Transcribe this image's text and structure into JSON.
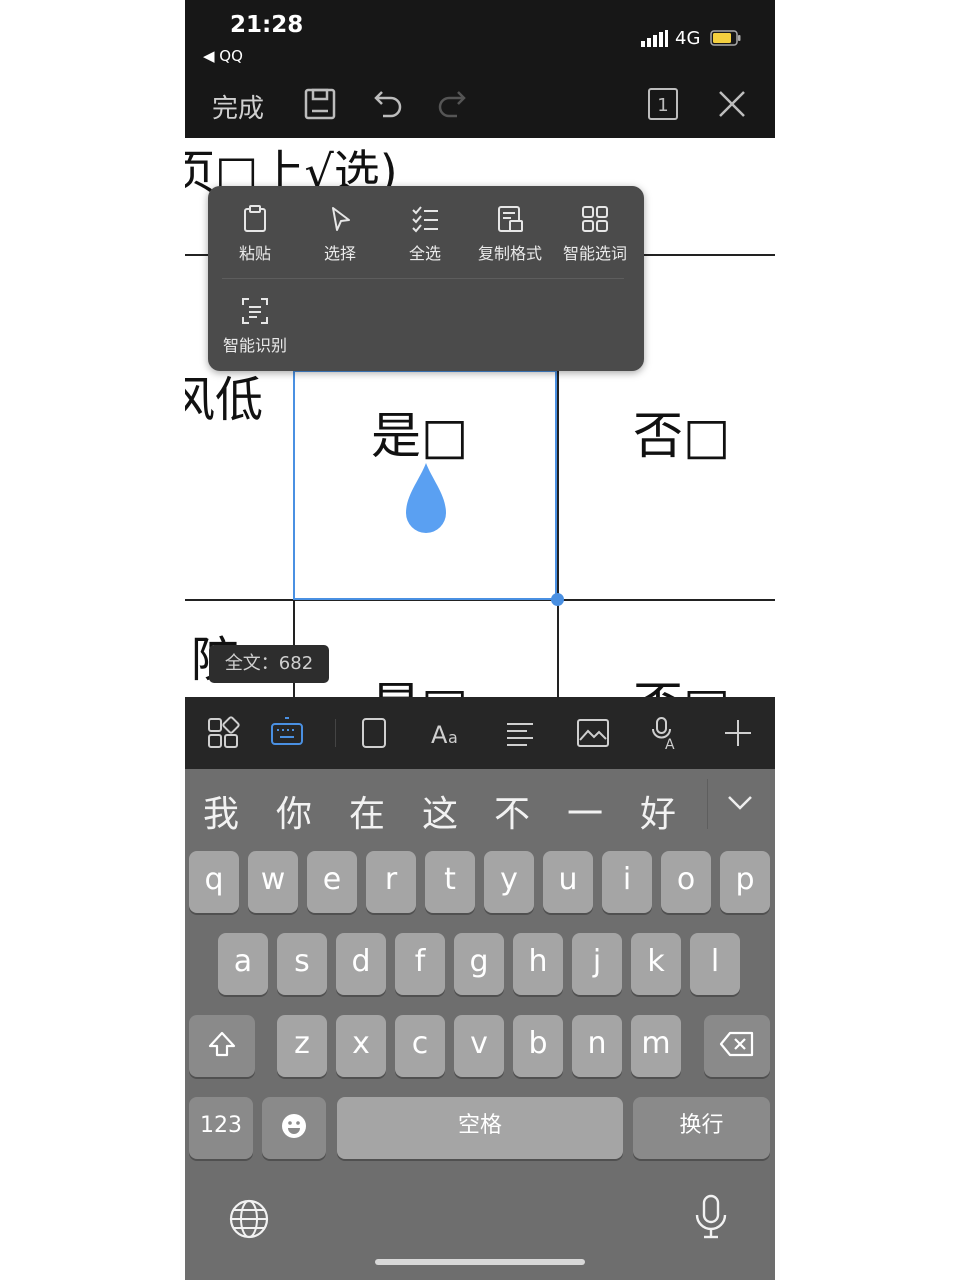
{
  "status_bar": {
    "time": "21:28",
    "back_app": "◀ QQ",
    "network": "4G"
  },
  "toolbar": {
    "done_label": "完成",
    "page_indicator": "1"
  },
  "document": {
    "line1_fragment": "页□上√选)",
    "row_label_fragment": "风低",
    "cell_yes": "是□",
    "cell_no": "否□",
    "row2_fragment": "院",
    "row2_yes": "是□",
    "row2_no": "否□"
  },
  "context_menu": {
    "items": [
      "粘贴",
      "选择",
      "全选",
      "复制格式",
      "智能选词"
    ],
    "items_row2": [
      "智能识别"
    ]
  },
  "word_count": "全文：682",
  "keyboard": {
    "candidates": [
      "我",
      "你",
      "在",
      "这",
      "不",
      "一",
      "好"
    ],
    "row1": [
      "q",
      "w",
      "e",
      "r",
      "t",
      "y",
      "u",
      "i",
      "o",
      "p"
    ],
    "row2": [
      "a",
      "s",
      "d",
      "f",
      "g",
      "h",
      "j",
      "k",
      "l"
    ],
    "row3": [
      "z",
      "x",
      "c",
      "v",
      "b",
      "n",
      "m"
    ],
    "numbers_label": "123",
    "space_label": "空格",
    "return_label": "换行"
  },
  "colors": {
    "accent": "#5aa0f2",
    "selection_border": "#4a90e2",
    "toolbar_bg": "#171717",
    "keyboard_bg": "#6e6e6e"
  },
  "icons": [
    "save-icon",
    "undo-icon",
    "redo-icon",
    "page-icon",
    "close-icon",
    "paste-icon",
    "select-icon",
    "select-all-icon",
    "copy-format-icon",
    "smart-select-icon",
    "smart-recognize-icon",
    "apps-icon",
    "keyboard-icon",
    "frame-icon",
    "font-icon",
    "align-icon",
    "image-icon",
    "voice-translate-icon",
    "plus-icon",
    "chevron-down-icon",
    "shift-icon",
    "delete-icon",
    "emoji-icon",
    "globe-icon",
    "mic-icon"
  ]
}
